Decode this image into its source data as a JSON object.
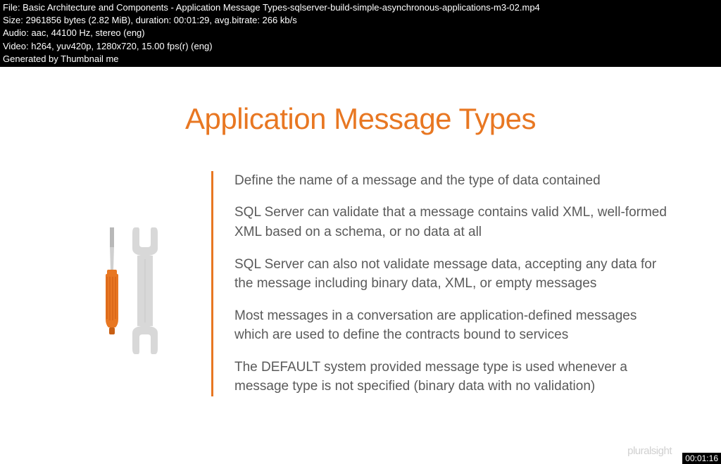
{
  "header": {
    "file": "File: Basic Architecture and Components - Application Message Types-sqlserver-build-simple-asynchronous-applications-m3-02.mp4",
    "size": "Size: 2961856 bytes (2.82 MiB), duration: 00:01:29, avg.bitrate: 266 kb/s",
    "audio": "Audio: aac, 44100 Hz, stereo (eng)",
    "video": "Video: h264, yuv420p, 1280x720, 15.00 fps(r) (eng)",
    "generated": "Generated by Thumbnail me"
  },
  "slide": {
    "title": "Application Message Types",
    "bullets": [
      "Define the name of a message and the type of data contained",
      "SQL Server can validate that a message contains valid XML, well-formed XML based on a schema, or no data at all",
      "SQL Server can also not validate message data, accepting any data for the message including binary data, XML, or empty messages",
      "Most messages in a conversation are application-defined messages which are used to define the contracts bound to services",
      "The DEFAULT system provided message type is used whenever a message type is not specified (binary data with no validation)"
    ]
  },
  "brand": "pluralsight",
  "timestamp": "00:01:16"
}
